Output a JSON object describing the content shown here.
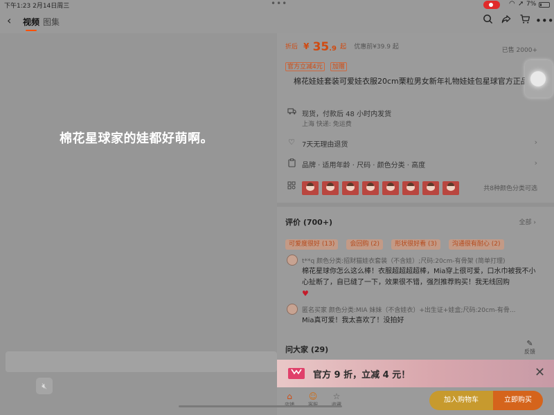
{
  "status": {
    "time": "下午1:23",
    "date": "2月14日周三",
    "battery": "7%"
  },
  "nav": {
    "tabs": [
      "视频",
      "图集"
    ],
    "icons": [
      "back-icon",
      "search-icon",
      "share-icon",
      "cart-icon",
      "more-icon"
    ]
  },
  "video": {
    "caption": "棉花星球家的娃都好萌啊。"
  },
  "product": {
    "price_prefix": "折后",
    "currency": "¥",
    "price_int": "35",
    "price_dec": ".9",
    "price_suffix": "起",
    "orig_price": "优惠前¥39.9 起",
    "sold": "已售 2000+",
    "badges": [
      "官方立减4元",
      "加赠"
    ],
    "title": "棉花娃娃套装可爱娃衣服20cm栗粒男女新年礼物娃娃包星球官方正品",
    "shipping": "现货，付款后 48 小时内发货",
    "shipping_sub": "上海  快递: 免运费",
    "returns": "7天无理由退货",
    "params": "品牌 · 适用年龄 · 尺码 · 颜色分类 · 高度",
    "variants_count": "共8种颜色分类可选"
  },
  "reviews": {
    "title": "评价 (700+)",
    "all": "全部",
    "chips": [
      "可爱度很好 (13)",
      "会回购 (2)",
      "形状很好看 (3)",
      "沟通很有耐心 (2)"
    ],
    "items": [
      {
        "user": "t**q",
        "meta": "颜色分类:招财猫娃衣套装（不含娃）;尺码:20cm-有骨架 (简单打理)",
        "text": "棉花星球你怎么这么棒！衣服超超超超棒，Mia穿上很可爱，口水巾被我不小心扯断了，自已缝了一下，效果很不错，强烈推荐购买！我无线回购"
      },
      {
        "user": "匿名买家",
        "meta": "颜色分类:MIA 妹妹（不含娃衣）+出生证+娃盒;尺码:20cm-有骨...",
        "text": "Mia真可爱！我太喜欢了！没拍好"
      }
    ]
  },
  "ask": {
    "title": "问大家 (29)",
    "feedback": "反馈"
  },
  "promo": {
    "text": "官方 9 折，立减 4 元！"
  },
  "bottom": {
    "shop": "店铺",
    "service": "客服",
    "favorite": "收藏",
    "cart_button": "加入购物车",
    "buy_button": "立即购买"
  }
}
